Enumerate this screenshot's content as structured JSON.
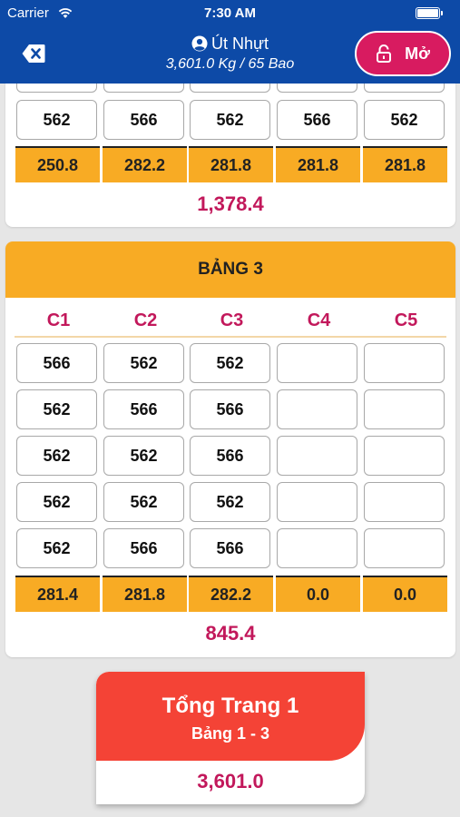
{
  "status": {
    "carrier": "Carrier",
    "time": "7:30 AM"
  },
  "nav": {
    "title": "Út Nhựt",
    "subtitle": "3,601.0 Kg / 65 Bao",
    "open_label": "Mở"
  },
  "table2": {
    "visible_row": [
      "562",
      "566",
      "562",
      "566",
      "562"
    ],
    "sums": [
      "250.8",
      "282.2",
      "281.8",
      "281.8",
      "281.8"
    ],
    "total": "1,378.4"
  },
  "table3": {
    "title": "BẢNG 3",
    "columns": [
      "C1",
      "C2",
      "C3",
      "C4",
      "C5"
    ],
    "rows": [
      [
        "566",
        "562",
        "562",
        "",
        ""
      ],
      [
        "562",
        "566",
        "566",
        "",
        ""
      ],
      [
        "562",
        "562",
        "566",
        "",
        ""
      ],
      [
        "562",
        "562",
        "562",
        "",
        ""
      ],
      [
        "562",
        "566",
        "566",
        "",
        ""
      ]
    ],
    "sums": [
      "281.4",
      "281.8",
      "282.2",
      "0.0",
      "0.0"
    ],
    "total": "845.4"
  },
  "page_total": {
    "title": "Tổng Trang 1",
    "subtitle": "Bảng 1 - 3",
    "value": "3,601.0"
  },
  "colors": {
    "nav_bg": "#0d4aa7",
    "accent_orange": "#f8ab24",
    "accent_pink": "#c2185b",
    "button_pink": "#d81b60",
    "total_red": "#f44336"
  }
}
